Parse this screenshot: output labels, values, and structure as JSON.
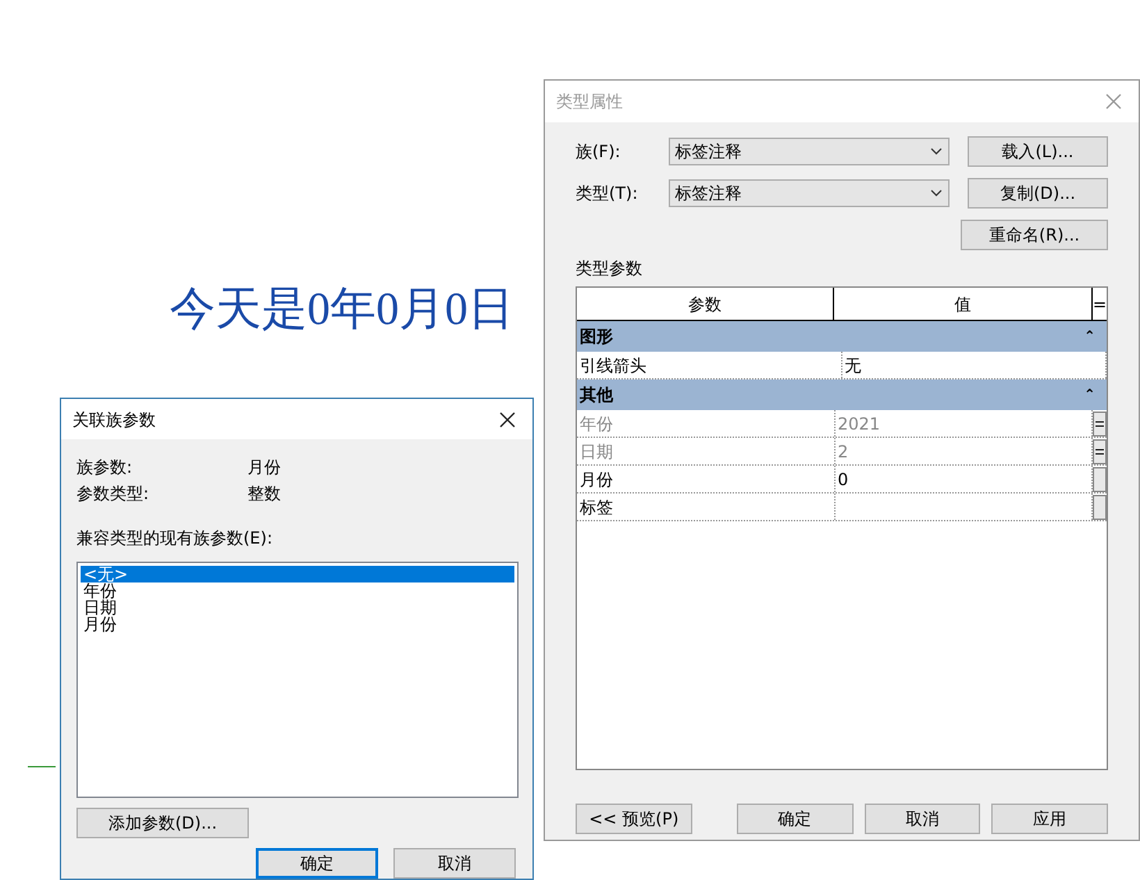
{
  "canvas": {
    "label_text": "今天是0年0月0日"
  },
  "type_properties": {
    "title": "类型属性",
    "fields": [
      {
        "label": "族(F):",
        "value": "标签注释",
        "button": "载入(L)..."
      },
      {
        "label": "类型(T):",
        "value": "标签注释",
        "button": "复制(D)..."
      }
    ],
    "rename_button": "重命名(R)...",
    "section_label": "类型参数",
    "table": {
      "columns": [
        "参数",
        "值",
        "="
      ],
      "groups": [
        {
          "name": "图形",
          "collapse_glyph": "⌃",
          "rows": [
            {
              "param": "引线箭头",
              "value": "无",
              "disabled": false
            }
          ]
        },
        {
          "name": "其他",
          "collapse_glyph": "⌃",
          "rows": [
            {
              "param": "年份",
              "value": "2021",
              "disabled": true,
              "kind": "equals"
            },
            {
              "param": "日期",
              "value": "2",
              "disabled": true,
              "kind": "equals"
            },
            {
              "param": "月份",
              "value": "0",
              "disabled": false,
              "kind": "box"
            },
            {
              "param": "标签",
              "disabled": false,
              "kind": "box"
            }
          ]
        }
      ]
    },
    "buttons": [
      "<< 预览(P)",
      "确定",
      "取消",
      "应用"
    ]
  },
  "associate_dialog": {
    "title": "关联族参数",
    "info": [
      {
        "label": "族参数:",
        "value": "月份"
      },
      {
        "label": "参数类型:",
        "value": "整数"
      }
    ],
    "list_label": "兼容类型的现有族参数(E):",
    "list": [
      {
        "label": "<无>",
        "selected": true
      },
      {
        "label": "年份",
        "selected": false
      },
      {
        "label": "日期",
        "selected": false
      },
      {
        "label": "月份",
        "selected": false
      }
    ],
    "add_button": "添加参数(D)...",
    "buttons": [
      {
        "label": "确定",
        "default": true
      },
      {
        "label": "取消",
        "default": false
      }
    ]
  }
}
